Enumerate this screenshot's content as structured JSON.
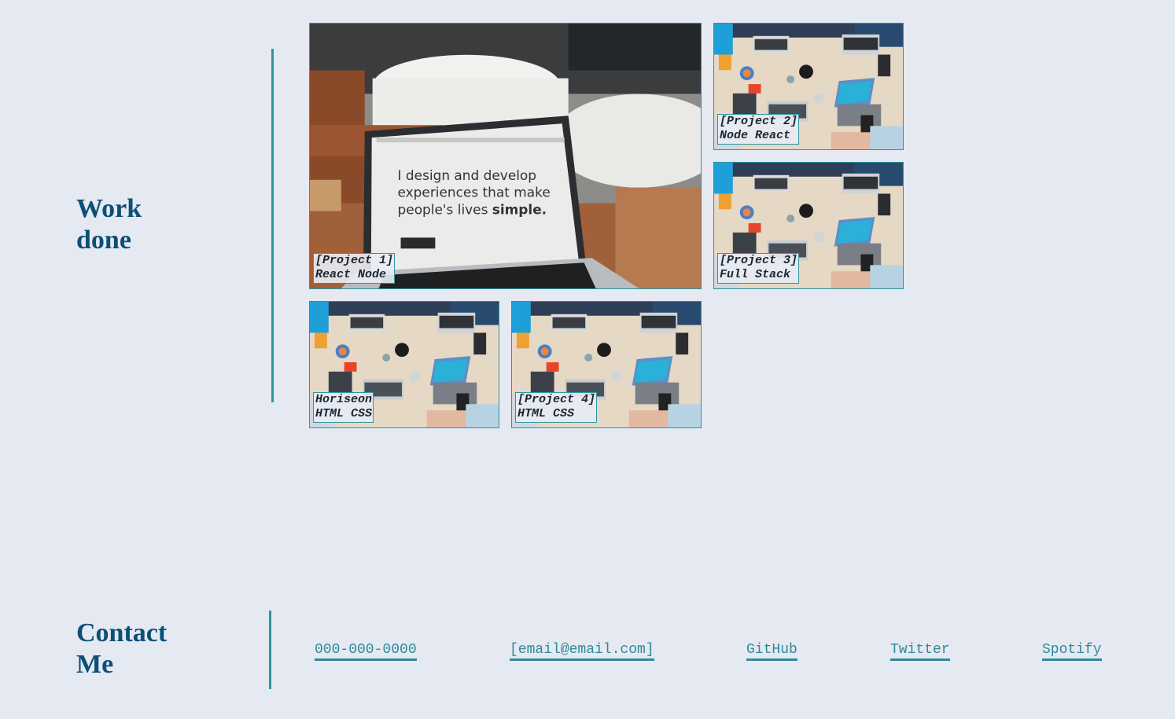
{
  "work": {
    "heading_line1": "Work",
    "heading_line2": "done",
    "projects": [
      {
        "line1": "[Project 1]",
        "line2": "React Node",
        "image": "laptop-cafe-photo",
        "screen_text": [
          "I design and develop",
          "experiences that make",
          "people's lives "
        ],
        "screen_bold": "simple."
      },
      {
        "line1": "[Project 2]",
        "line2": "Node React",
        "image": "team-desk-photo"
      },
      {
        "line1": "[Project 3]",
        "line2": "Full Stack",
        "image": "team-desk-photo"
      },
      {
        "line1": "Horiseon",
        "line2": "HTML CSS",
        "image": "team-desk-photo"
      },
      {
        "line1": "[Project 4]",
        "line2": "HTML CSS",
        "image": "team-desk-photo"
      }
    ]
  },
  "contact": {
    "heading_line1": "Contact",
    "heading_line2": "Me",
    "links": [
      {
        "label": "000-000-0000"
      },
      {
        "label": "[email@email.com]"
      },
      {
        "label": "GitHub"
      },
      {
        "label": "Twitter"
      },
      {
        "label": "Spotify"
      }
    ]
  },
  "colors": {
    "background": "#e5e9f1",
    "heading": "#0c4f78",
    "accent": "#2e94a0",
    "link": "#2e8a99"
  }
}
